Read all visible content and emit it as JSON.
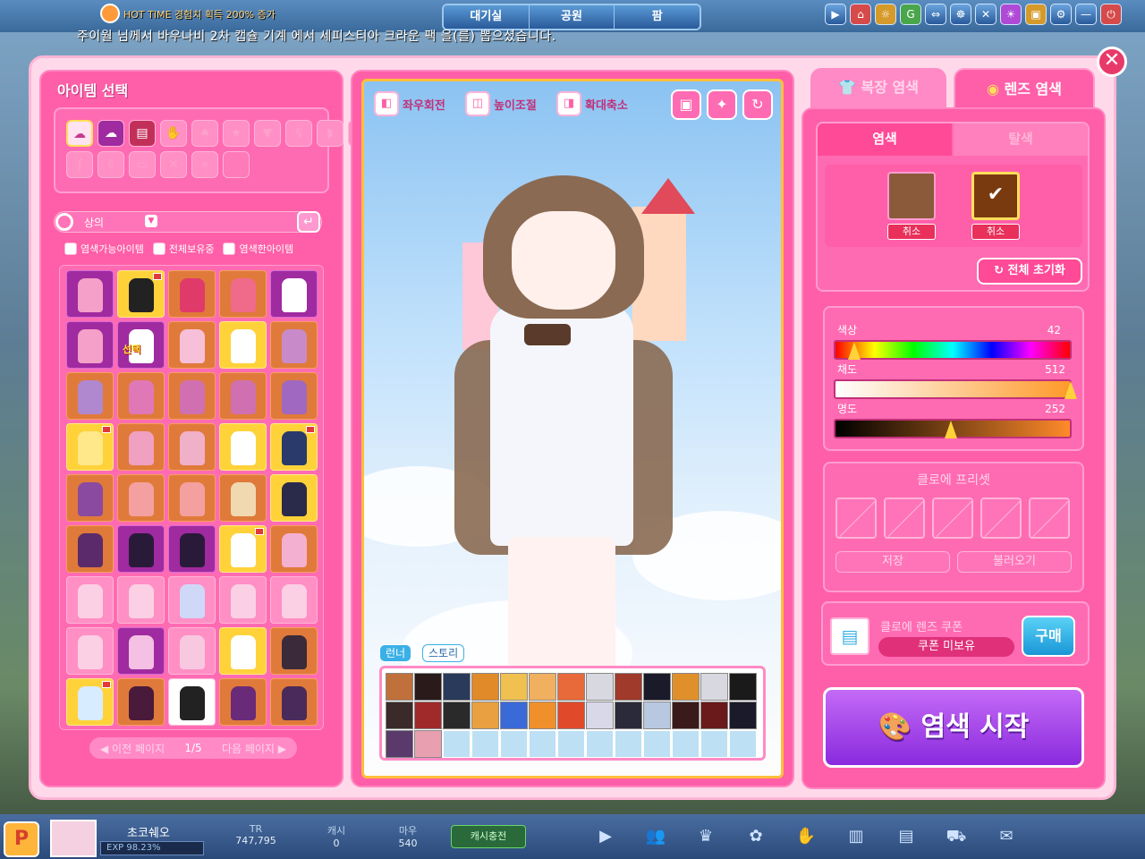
{
  "hud": {
    "hot_time": "HOT TIME 경험치 획득 200% 증가",
    "top_tabs": [
      "대기실",
      "공원",
      "팜"
    ],
    "top_icons": [
      "▶",
      "⌂",
      "☼",
      "G",
      "⇔",
      "☸",
      "✕",
      "☀",
      "▣",
      "⚙",
      "—",
      "⏻"
    ],
    "notice": "주이월 님께서 바우나비 2차 캡슐 기계 에서 세피스티아 크라운 팩 을(를) 뽑으셨습니다."
  },
  "left_panel": {
    "title": "아이템 선택",
    "category_icons": [
      "shirt-icon",
      "shirt2-icon",
      "skirt-icon",
      "glove-icon",
      "bag-icon",
      "star-icon",
      "down-icon",
      "spiral-icon",
      "shoe-icon",
      "face-icon",
      "leg-icon",
      "hand-icon",
      "hat-icon",
      "cross-icon",
      "arrow-icon",
      "blank-icon"
    ],
    "search_category": "상의",
    "filters": [
      "염색가능아이템",
      "전체보유중",
      "염색한아이템"
    ],
    "selected_label": "선택",
    "pager": {
      "prev": "이전 페이지",
      "page": "1/5",
      "next": "다음 페이지"
    }
  },
  "center_panel": {
    "controls": [
      "좌우회전",
      "높이조절",
      "확대축소"
    ],
    "mode_tabs": [
      "런너",
      "스토리"
    ]
  },
  "right_panel": {
    "tabs": [
      "복장 염색",
      "렌즈 염색"
    ],
    "subtabs": [
      "염색",
      "탈색"
    ],
    "cancel_label": "취소",
    "reset_label": "전체 초기화",
    "sliders": [
      {
        "label": "색상",
        "value": "42"
      },
      {
        "label": "채도",
        "value": "512"
      },
      {
        "label": "명도",
        "value": "252"
      }
    ],
    "preset_title": "클로에 프리셋",
    "save_label": "저장",
    "load_label": "불러오기",
    "coupon_title": "클로에 렌즈 쿠폰",
    "coupon_status": "쿠폰 미보유",
    "buy_label": "구매",
    "start_label": "염색 시작",
    "colors": {
      "swatch1": "#8a5a3a",
      "swatch2": "#7a3a10"
    }
  },
  "bottom_bar": {
    "player_name": "초코쉐오",
    "exp": "EXP 98.23%",
    "stats": [
      {
        "label": "TR",
        "value": "747,795"
      },
      {
        "label": "캐시",
        "value": "0"
      },
      {
        "label": "마우",
        "value": "540"
      }
    ],
    "charge_label": "캐시충전"
  }
}
